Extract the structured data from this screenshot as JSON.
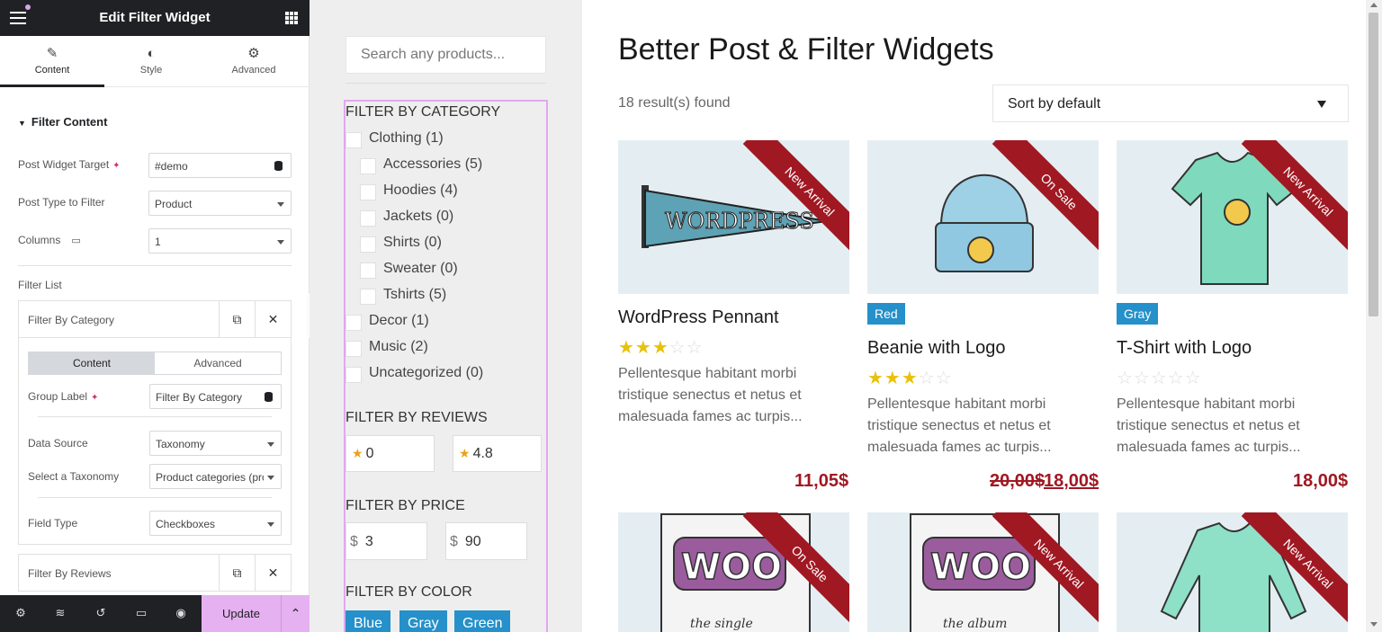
{
  "panel": {
    "title": "Edit Filter Widget",
    "tabs": [
      {
        "label": "Content",
        "icon": "pencil-icon"
      },
      {
        "label": "Style",
        "icon": "contrast-icon"
      },
      {
        "label": "Advanced",
        "icon": "gear-icon"
      }
    ],
    "section_title": "Filter Content",
    "post_widget_target": {
      "label": "Post Widget Target",
      "value": "#demo"
    },
    "post_type": {
      "label": "Post Type to Filter",
      "value": "Product"
    },
    "columns": {
      "label": "Columns",
      "value": "1"
    },
    "filter_list_label": "Filter List",
    "repeater_items": [
      "Filter By Category",
      "Filter By Reviews"
    ],
    "inner_tabs": {
      "content": "Content",
      "advanced": "Advanced"
    },
    "group_label": {
      "label": "Group Label",
      "value": "Filter By Category"
    },
    "data_source": {
      "label": "Data Source",
      "value": "Taxonomy"
    },
    "taxonomy": {
      "label": "Select a Taxonomy",
      "value": "Product categories (pro"
    },
    "field_type": {
      "label": "Field Type",
      "value": "Checkboxes"
    },
    "update_label": "Update"
  },
  "filters": {
    "search_placeholder": "Search any products...",
    "category_heading": "FILTER BY CATEGORY",
    "categories": [
      {
        "label": "Clothing (1)",
        "indent": 0
      },
      {
        "label": "Accessories (5)",
        "indent": 1
      },
      {
        "label": "Hoodies (4)",
        "indent": 1
      },
      {
        "label": "Jackets (0)",
        "indent": 1
      },
      {
        "label": "Shirts (0)",
        "indent": 1
      },
      {
        "label": "Sweater (0)",
        "indent": 1
      },
      {
        "label": "Tshirts (5)",
        "indent": 1
      },
      {
        "label": "Decor (1)",
        "indent": 0
      },
      {
        "label": "Music (2)",
        "indent": 0
      },
      {
        "label": "Uncategorized (0)",
        "indent": 0
      }
    ],
    "reviews_heading": "FILTER BY REVIEWS",
    "reviews": {
      "min": "0",
      "max": "4.8",
      "star": "★"
    },
    "price_heading": "FILTER BY PRICE",
    "price": {
      "currency": "$",
      "min": "3",
      "max": "90"
    },
    "color_heading": "FILTER BY COLOR",
    "colors": [
      "Blue",
      "Gray",
      "Green"
    ]
  },
  "main": {
    "title": "Better Post & Filter Widgets",
    "results": "18 result(s) found",
    "sort_value": "Sort by default",
    "products": [
      {
        "name": "WordPress Pennant",
        "ribbon": "New Arrival",
        "rating": 3,
        "desc": [
          "Pellentesque habitant morbi",
          "tristique senectus et netus et",
          "malesuada fames ac turpis..."
        ],
        "price": "11,05$",
        "old_price": "",
        "tag": ""
      },
      {
        "name": "Beanie with Logo",
        "ribbon": "On Sale",
        "rating": 3,
        "desc": [
          "Pellentesque habitant morbi",
          "tristique senectus et netus et",
          "malesuada fames ac turpis..."
        ],
        "price": "18,00$",
        "old_price": "20,00$",
        "tag": "Red"
      },
      {
        "name": "T-Shirt with Logo",
        "ribbon": "New Arrival",
        "rating": 0,
        "desc": [
          "Pellentesque habitant morbi",
          "tristique senectus et netus et",
          "malesuada fames ac turpis..."
        ],
        "price": "18,00$",
        "old_price": "",
        "tag": "Gray"
      }
    ],
    "row2_ribbons": [
      "On Sale",
      "New Arrival",
      "New Arrival"
    ],
    "pennant_text": "WORDPRESS",
    "woo_text": "WOO",
    "woo_captions": [
      "the single",
      "the album"
    ]
  },
  "colors": {
    "accent": "#e6b1f0",
    "ribbon": "#a01822",
    "tag": "#2590c9",
    "star": "#e8c10a"
  }
}
